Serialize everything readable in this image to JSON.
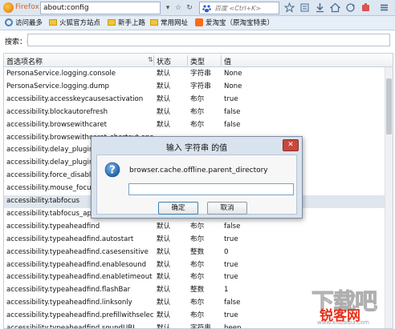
{
  "navbar": {
    "browser_label": "Firefox",
    "url": "about:config",
    "search_placeholder": "百度 <Ctrl+K>"
  },
  "bookmarks": [
    {
      "label": "访问最多",
      "icon": "gear-icon"
    },
    {
      "label": "火狐官方站点",
      "icon": "folder-icon"
    },
    {
      "label": "新手上路",
      "icon": "folder-icon"
    },
    {
      "label": "常用网址",
      "icon": "folder-icon"
    },
    {
      "label": "爱淘宝（原淘宝特卖）",
      "icon": "taobao-icon"
    }
  ],
  "filter": {
    "label": "搜索：(R)"
  },
  "table": {
    "headers": {
      "name": "首选项名称",
      "status": "状态",
      "type": "类型",
      "value": "值"
    },
    "rows": [
      {
        "name": "PersonaService.logging.console",
        "status": "默认",
        "type": "字符串",
        "value": "None"
      },
      {
        "name": "PersonaService.logging.dump",
        "status": "默认",
        "type": "字符串",
        "value": "None"
      },
      {
        "name": "accessibility.accesskeycausesactivation",
        "status": "默认",
        "type": "布尔",
        "value": "true"
      },
      {
        "name": "accessibility.blockautorefresh",
        "status": "默认",
        "type": "布尔",
        "value": "false"
      },
      {
        "name": "accessibility.browsewithcaret",
        "status": "默认",
        "type": "布尔",
        "value": "false"
      },
      {
        "name": "accessibility.browsewithcaret_shortcut.enabled",
        "status": "",
        "type": "",
        "value": ""
      },
      {
        "name": "accessibility.delay_plugin_time",
        "status": "",
        "type": "",
        "value": ""
      },
      {
        "name": "accessibility.delay_plugins",
        "status": "",
        "type": "",
        "value": ""
      },
      {
        "name": "accessibility.force_disabled",
        "status": "",
        "type": "",
        "value": ""
      },
      {
        "name": "accessibility.mouse_focuses_formcontrol",
        "status": "",
        "type": "",
        "value": ""
      },
      {
        "name": "accessibility.tabfocus",
        "status": "",
        "type": "",
        "value": ""
      },
      {
        "name": "accessibility.tabfocus_applies_to_xul",
        "status": "",
        "type": "",
        "value": ""
      },
      {
        "name": "accessibility.typeaheadfind",
        "status": "默认",
        "type": "布尔",
        "value": "false"
      },
      {
        "name": "accessibility.typeaheadfind.autostart",
        "status": "默认",
        "type": "布尔",
        "value": "true"
      },
      {
        "name": "accessibility.typeaheadfind.casesensitive",
        "status": "默认",
        "type": "整数",
        "value": "0"
      },
      {
        "name": "accessibility.typeaheadfind.enablesound",
        "status": "默认",
        "type": "布尔",
        "value": "true"
      },
      {
        "name": "accessibility.typeaheadfind.enabletimeout",
        "status": "默认",
        "type": "布尔",
        "value": "true"
      },
      {
        "name": "accessibility.typeaheadfind.flashBar",
        "status": "默认",
        "type": "整数",
        "value": "1"
      },
      {
        "name": "accessibility.typeaheadfind.linksonly",
        "status": "默认",
        "type": "布尔",
        "value": "false"
      },
      {
        "name": "accessibility.typeaheadfind.prefillwithselection",
        "status": "默认",
        "type": "布尔",
        "value": "true"
      },
      {
        "name": "accessibility.typeaheadfind.soundURL",
        "status": "默认",
        "type": "字符串",
        "value": "beep"
      }
    ],
    "selected_row": 10
  },
  "dialog": {
    "title": "输入 字符串 的值",
    "message": "browser.cache.offline.parent_directory",
    "input_value": "",
    "ok_label": "确定",
    "cancel_label": "取消"
  },
  "watermark": {
    "big": "下载吧",
    "brand": "锐客网",
    "url": "www.xiazaiba.com"
  }
}
